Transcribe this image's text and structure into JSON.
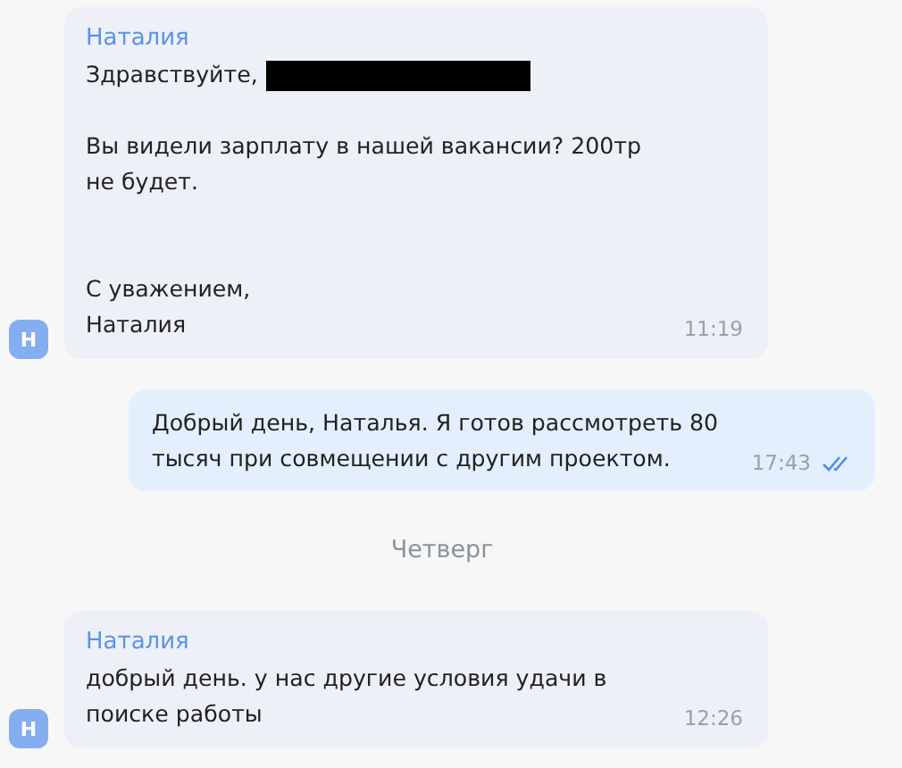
{
  "messages": [
    {
      "kind": "incoming",
      "avatar": "Н",
      "sender": "Наталия",
      "greeting": {
        "text": "Здравствуйте,",
        "redacted": true
      },
      "text": "Вы видели зарплату в нашей вакансии? 200тр не будет.\n\n\nС уважением,\nНаталия",
      "time": "11:19"
    },
    {
      "kind": "outgoing",
      "text": "Добрый день, Наталья. Я готов рассмотреть 80 тысяч при совмещении с другим проектом.",
      "time": "17:43",
      "read": true
    },
    {
      "kind": "date",
      "text": "Четверг"
    },
    {
      "kind": "incoming",
      "avatar": "Н",
      "sender": "Наталия",
      "text": "добрый день. у нас другие условия удачи в поиске работы",
      "time": "12:26"
    }
  ]
}
